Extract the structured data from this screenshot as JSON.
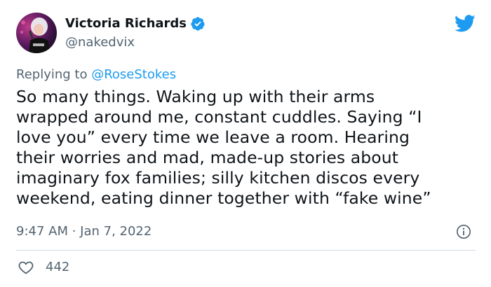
{
  "author": {
    "display_name": "Victoria Richards",
    "handle": "@nakedvix",
    "avatar_icon": "avatar",
    "verified_icon": "verified-badge-icon"
  },
  "brand": {
    "logo_icon": "twitter-bird-icon",
    "accent_color": "#1d9bf0"
  },
  "reply": {
    "prefix": "Replying to ",
    "mention": "@RoseStokes"
  },
  "tweet": {
    "text": "So many things. Waking up with their arms\nwrapped around me, constant cuddles. Saying “I\nlove you” every time we leave a room. Hearing\ntheir worries and mad, made-up stories about\nimaginary fox families; silly kitchen discos every\nweekend, eating dinner together with “fake wine”",
    "timestamp": "9:47 AM · Jan 7, 2022"
  },
  "actions": {
    "like_icon": "heart-icon",
    "like_count": "442",
    "info_icon": "info-icon"
  }
}
